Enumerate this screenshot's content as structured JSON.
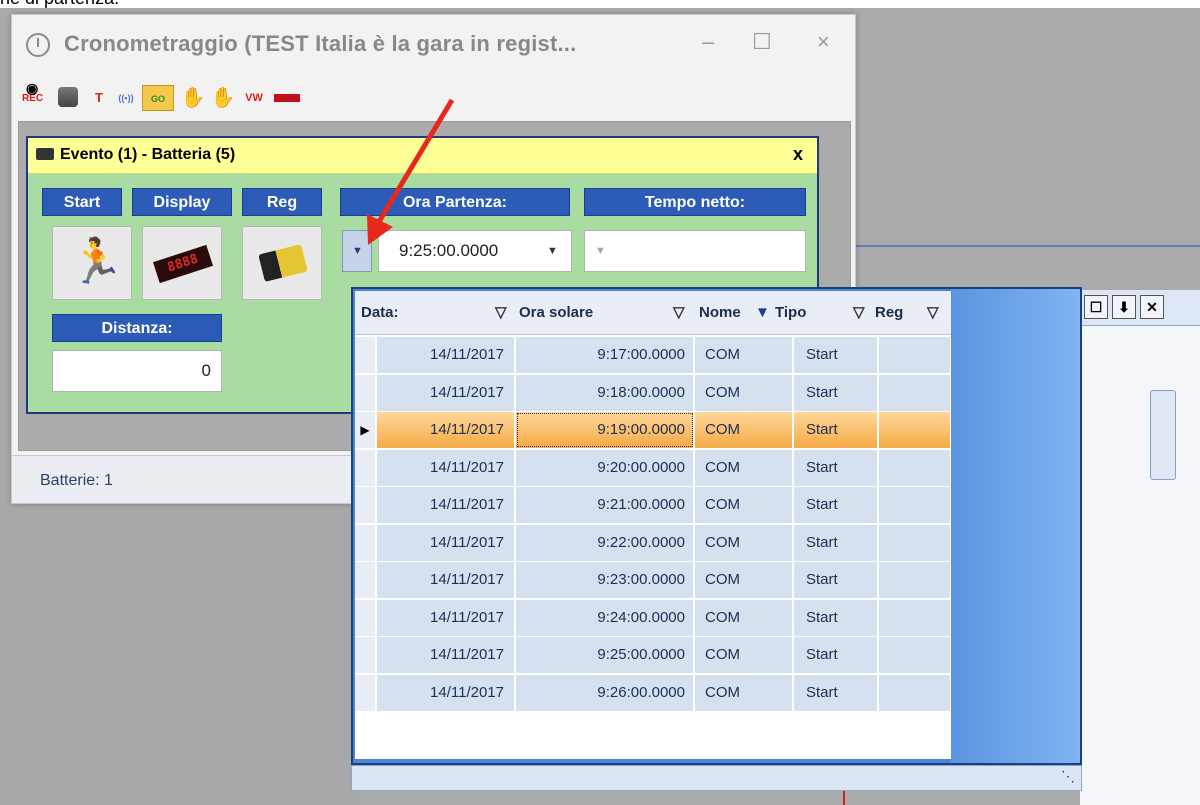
{
  "partial_text": "ne di partenza.",
  "window": {
    "title": "Cronometraggio (TEST Italia è la gara in regist...",
    "minimize": "–",
    "maximize": "☐",
    "close": "×",
    "toolbar": [
      {
        "name": "rec-icon",
        "label": "REC",
        "color": "#e0191b"
      },
      {
        "name": "stop-rec-icon",
        "label": "",
        "color": "#555555"
      },
      {
        "name": "transponder-icon",
        "label": "T",
        "color": "#3a5b9c"
      },
      {
        "name": "signal-icon",
        "label": "((•))",
        "color": "#5a6cc4"
      },
      {
        "name": "camera-go-icon",
        "label": "GO",
        "color": "#2f8b2f"
      },
      {
        "name": "green-hand-icon",
        "label": "✋",
        "color": "#1d9a2a"
      },
      {
        "name": "red-hand-icon",
        "label": "✋",
        "color": "#d8241c"
      },
      {
        "name": "vw-icon",
        "label": "VW",
        "color": "#d8241c"
      },
      {
        "name": "display-board-icon",
        "label": "",
        "color": "#c1121a"
      }
    ],
    "status": "Batterie: 1"
  },
  "event": {
    "title": "Evento (1) - Batteria (5)",
    "close": "x",
    "headers": {
      "start": "Start",
      "display": "Display",
      "reg": "Reg",
      "ora_partenza": "Ora Partenza:",
      "tempo_netto": "Tempo netto:",
      "distanza": "Distanza:"
    },
    "display_digits": "8888",
    "ora_partenza": "9:25:00.0000",
    "tempo_netto": "",
    "distanza": "0"
  },
  "grid": {
    "columns": [
      "Data:",
      "Ora solare",
      "Nome",
      "Tipo",
      "Reg"
    ],
    "rows": [
      {
        "data": "14/11/2017",
        "ora": "9:17:00.0000",
        "nome": "COM",
        "tipo": "Start",
        "reg": ""
      },
      {
        "data": "14/11/2017",
        "ora": "9:18:00.0000",
        "nome": "COM",
        "tipo": "Start",
        "reg": ""
      },
      {
        "data": "14/11/2017",
        "ora": "9:19:00.0000",
        "nome": "COM",
        "tipo": "Start",
        "reg": "",
        "selected": true
      },
      {
        "data": "14/11/2017",
        "ora": "9:20:00.0000",
        "nome": "COM",
        "tipo": "Start",
        "reg": ""
      },
      {
        "data": "14/11/2017",
        "ora": "9:21:00.0000",
        "nome": "COM",
        "tipo": "Start",
        "reg": ""
      },
      {
        "data": "14/11/2017",
        "ora": "9:22:00.0000",
        "nome": "COM",
        "tipo": "Start",
        "reg": ""
      },
      {
        "data": "14/11/2017",
        "ora": "9:23:00.0000",
        "nome": "COM",
        "tipo": "Start",
        "reg": ""
      },
      {
        "data": "14/11/2017",
        "ora": "9:24:00.0000",
        "nome": "COM",
        "tipo": "Start",
        "reg": ""
      },
      {
        "data": "14/11/2017",
        "ora": "9:25:00.0000",
        "nome": "COM",
        "tipo": "Start",
        "reg": ""
      },
      {
        "data": "14/11/2017",
        "ora": "9:26:00.0000",
        "nome": "COM",
        "tipo": "Start",
        "reg": ""
      }
    ]
  },
  "side_panel": {
    "buttons": [
      "☐",
      "⬇",
      "✕"
    ]
  },
  "colors": {
    "accent": "#2c5bb8",
    "event_bg": "#a8dca0",
    "title_yellow": "#ffff96",
    "selected_row": "#f6aa45",
    "arrow": "#e8281c"
  }
}
